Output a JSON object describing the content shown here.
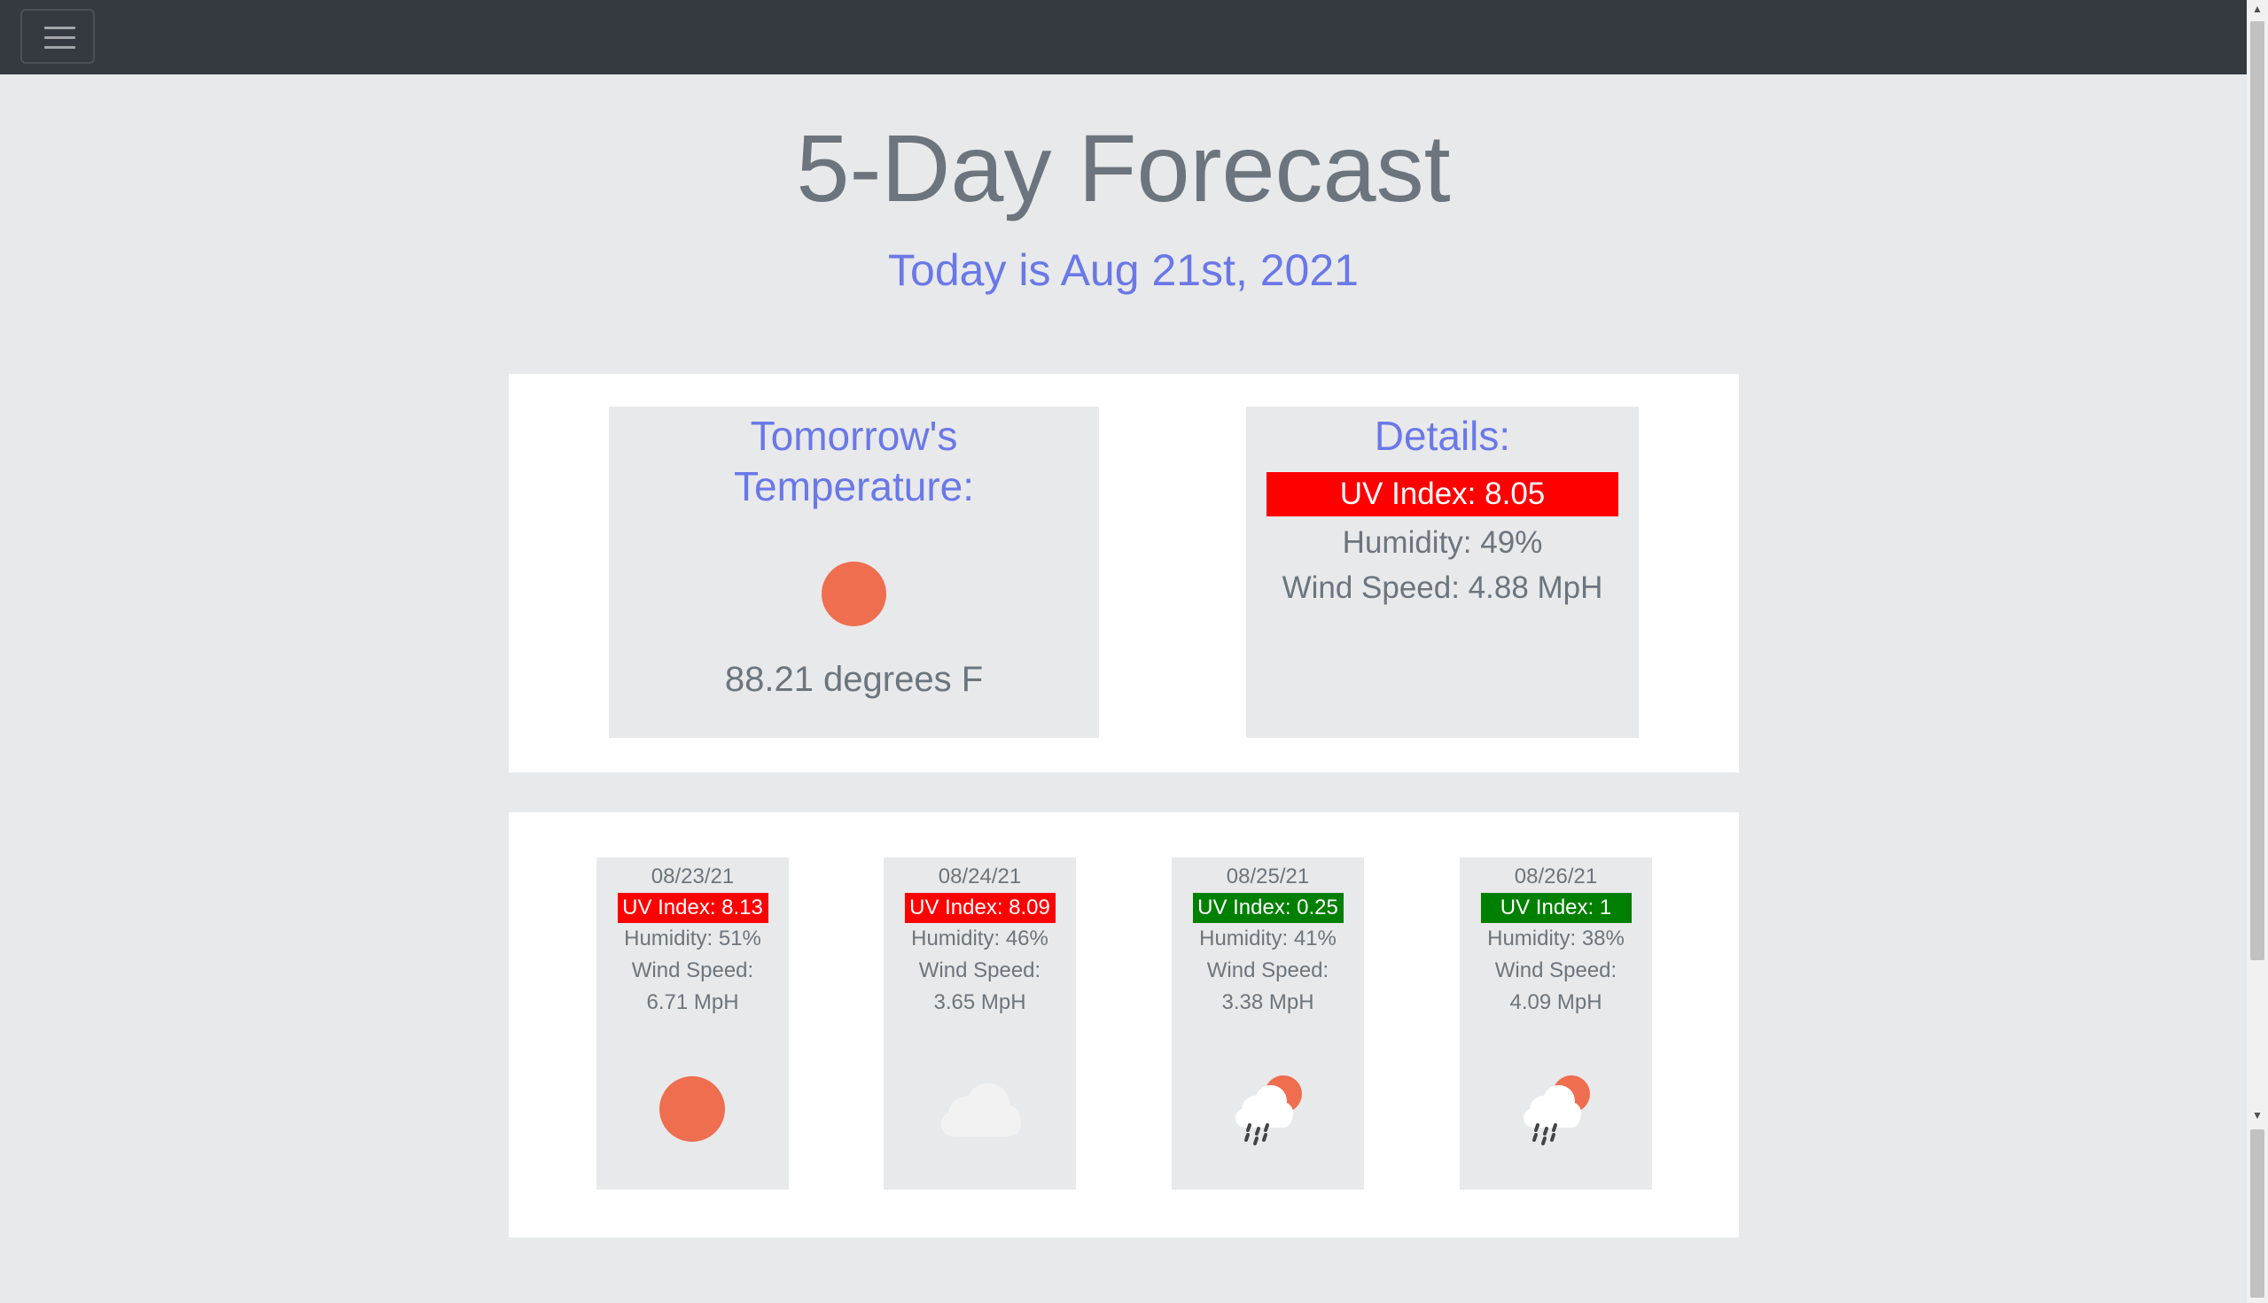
{
  "nav": {
    "menu_icon": "hamburger-menu-icon"
  },
  "page": {
    "title": "5-Day Forecast",
    "subtitle": "Today is Aug 21st, 2021"
  },
  "tomorrow": {
    "heading_line1": "Tomorrow's",
    "heading_line2": "Temperature:",
    "icon": "sun-icon",
    "temperature": "88.21 degrees F"
  },
  "details": {
    "heading": "Details:",
    "uv": "UV Index: 8.05",
    "uv_color": "#ff0000",
    "humidity": "Humidity: 49%",
    "wind": "Wind Speed: 4.88 MpH"
  },
  "forecast": [
    {
      "date": "08/23/21",
      "uv": "UV Index: 8.13",
      "uv_color": "#ff0000",
      "humidity": "Humidity: 51%",
      "wind_label": "Wind Speed:",
      "wind_value": "6.71 MpH",
      "icon": "sun-icon"
    },
    {
      "date": "08/24/21",
      "uv": "UV Index: 8.09",
      "uv_color": "#ff0000",
      "humidity": "Humidity: 46%",
      "wind_label": "Wind Speed:",
      "wind_value": "3.65 MpH",
      "icon": "cloud-icon"
    },
    {
      "date": "08/25/21",
      "uv": "UV Index: 0.25",
      "uv_color": "#008000",
      "humidity": "Humidity: 41%",
      "wind_label": "Wind Speed:",
      "wind_value": "3.38 MpH",
      "icon": "rain-sun-icon"
    },
    {
      "date": "08/26/21",
      "uv": "UV Index: 1",
      "uv_color": "#008000",
      "humidity": "Humidity: 38%",
      "wind_label": "Wind Speed:",
      "wind_value": "4.09 MpH",
      "icon": "rain-sun-icon"
    }
  ]
}
